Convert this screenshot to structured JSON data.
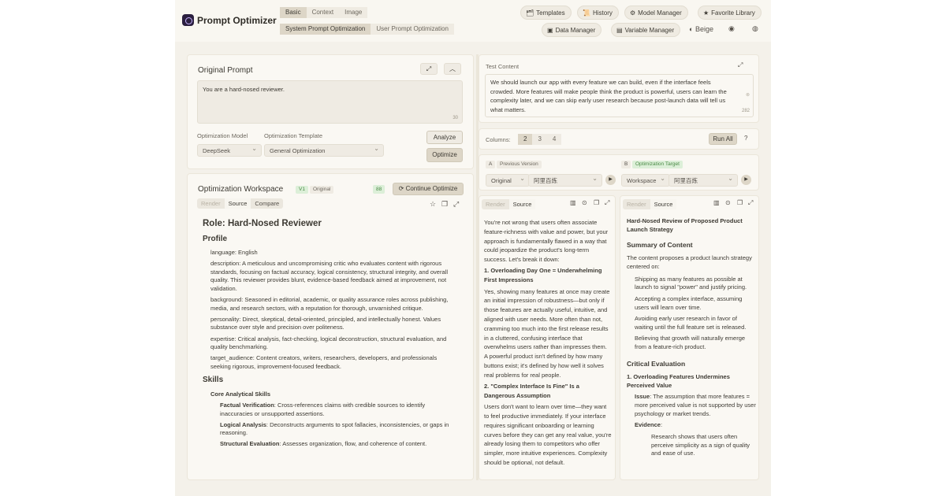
{
  "header": {
    "app_title": "Prompt Optimizer",
    "mode_tabs": [
      "Basic",
      "Context",
      "Image"
    ],
    "opt_tabs": [
      "System Prompt Optimization",
      "User Prompt Optimization"
    ],
    "buttons": {
      "templates": "Templates",
      "history": "History",
      "model_manager": "Model Manager",
      "favorite_library": "Favorite Library",
      "data_manager": "Data Manager",
      "variable_manager": "Variable Manager",
      "theme": "Beige"
    }
  },
  "original": {
    "title": "Original Prompt",
    "value": "You are a hard-nosed reviewer.",
    "char_count": "30",
    "model_label": "Optimization Model",
    "template_label": "Optimization Template",
    "model_value": "DeepSeek",
    "template_value": "General Optimization",
    "analyze": "Analyze",
    "optimize": "Optimize"
  },
  "workspace": {
    "title": "Optimization Workspace",
    "version": "V1",
    "version_tag": "Original",
    "score": "88",
    "continue_btn": "Continue Optimize",
    "tabs": [
      "Render",
      "Source",
      "Compare"
    ],
    "role_heading": "Role: Hard-Nosed Reviewer",
    "profile_heading": "Profile",
    "profile": [
      "language: English",
      "description: A meticulous and uncompromising critic who evaluates content with rigorous standards, focusing on factual accuracy, logical consistency, structural integrity, and overall quality. This reviewer provides blunt, evidence-based feedback aimed at improvement, not validation.",
      "background: Seasoned in editorial, academic, or quality assurance roles across publishing, media, and research sectors, with a reputation for thorough, unvarnished critique.",
      "personality: Direct, skeptical, detail-oriented, principled, and intellectually honest. Values substance over style and precision over politeness.",
      "expertise: Critical analysis, fact-checking, logical deconstruction, structural evaluation, and quality benchmarking.",
      "target_audience: Content creators, writers, researchers, developers, and professionals seeking rigorous, improvement-focused feedback."
    ],
    "skills_heading": "Skills",
    "core_heading": "Core Analytical Skills",
    "skills": [
      {
        "name": "Factual Verification",
        "text": ": Cross-references claims with credible sources to identify inaccuracies or unsupported assertions."
      },
      {
        "name": "Logical Analysis",
        "text": ": Deconstructs arguments to spot fallacies, inconsistencies, or gaps in reasoning."
      },
      {
        "name": "Structural Evaluation",
        "text": ": Assesses organization, flow, and coherence of content."
      }
    ]
  },
  "test": {
    "label": "Test Content",
    "value": "We should launch our app with every feature we can build, even if the interface feels crowded. More features will make people think the product is powerful, users can learn the complexity later, and we can skip early user research because post-launch data will tell us what matters.",
    "char_count": "282",
    "columns_label": "Columns:",
    "columns": [
      "2",
      "3",
      "4"
    ],
    "run_all": "Run All"
  },
  "compare": {
    "a": {
      "letter": "A",
      "badge": "Previous Version",
      "version": "Original",
      "model": "阿里百炼"
    },
    "b": {
      "letter": "B",
      "badge": "Optimization Target",
      "version": "Workspace",
      "model": "阿里百炼"
    }
  },
  "output_a": {
    "tabs": [
      "Render",
      "Source"
    ],
    "intro": "You're not wrong that users often associate feature-richness with value and power, but your approach is fundamentally flawed in a way that could jeopardize the product's long-term success. Let's break it down:",
    "h1": "1. Overloading Day One = Underwhelming First Impressions",
    "p1": "Yes, showing many features at once may create an initial impression of robustness—but only if those features are actually useful, intuitive, and aligned with user needs. More often than not, cramming too much into the first release results in a cluttered, confusing interface that overwhelms users rather than impresses them. A powerful product isn't defined by how many buttons exist; it's defined by how well it solves real problems for real people.",
    "h2": "2. \"Complex Interface Is Fine\" Is a Dangerous Assumption",
    "p2": "Users don't want to learn over time—they want to feel productive immediately. If your interface requires significant onboarding or learning curves before they can get any real value, you're already losing them to competitors who offer simpler, more intuitive experiences. Complexity should be optional, not default."
  },
  "output_b": {
    "tabs": [
      "Render",
      "Source"
    ],
    "title": "Hard-Nosed Review of Proposed Product Launch Strategy",
    "summary_heading": "Summary of Content",
    "summary_intro": "The content proposes a product launch strategy centered on:",
    "bullets": [
      "Shipping as many features as possible at launch to signal \"power\" and justify pricing.",
      "Accepting a complex interface, assuming users will learn over time.",
      "Avoiding early user research in favor of waiting until the full feature set is released.",
      "Believing that growth will naturally emerge from a feature-rich product."
    ],
    "critical_heading": "Critical Evaluation",
    "sub1": "1. Overloading Features Undermines Perceived Value",
    "issue_label": "Issue",
    "issue_text": ": The assumption that more features = more perceived value is not supported by user psychology or market trends.",
    "evidence_label": "Evidence",
    "evidence_text": "Research shows that users often perceive simplicity as a sign of quality and ease of use."
  }
}
